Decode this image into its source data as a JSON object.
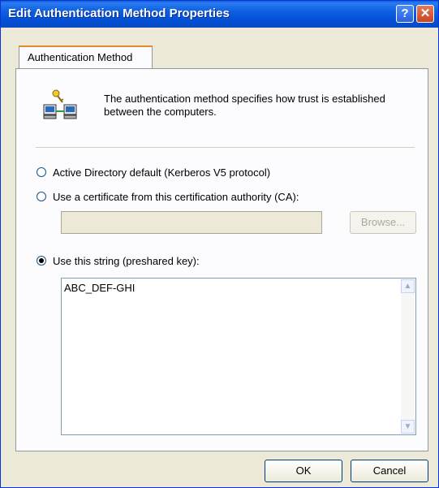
{
  "window": {
    "title": "Edit Authentication Method Properties",
    "help_label": "?",
    "close_label": "✕"
  },
  "tabs": [
    {
      "label": "Authentication Method",
      "selected": true
    }
  ],
  "description": "The authentication method specifies how trust is established between the computers.",
  "options": {
    "ad_default": {
      "label": "Active Directory default (Kerberos V5 protocol)",
      "checked": false
    },
    "certificate": {
      "label": "Use a certificate from this certification authority (CA):",
      "checked": false
    },
    "preshared": {
      "label": "Use this string (preshared key):",
      "checked": true
    }
  },
  "ca_field": {
    "value": ""
  },
  "browse_label": "Browse...",
  "preshared_key": {
    "value": "ABC_DEF-GHI"
  },
  "buttons": {
    "ok": "OK",
    "cancel": "Cancel"
  },
  "icons": {
    "network": "network-computers-key-icon"
  }
}
